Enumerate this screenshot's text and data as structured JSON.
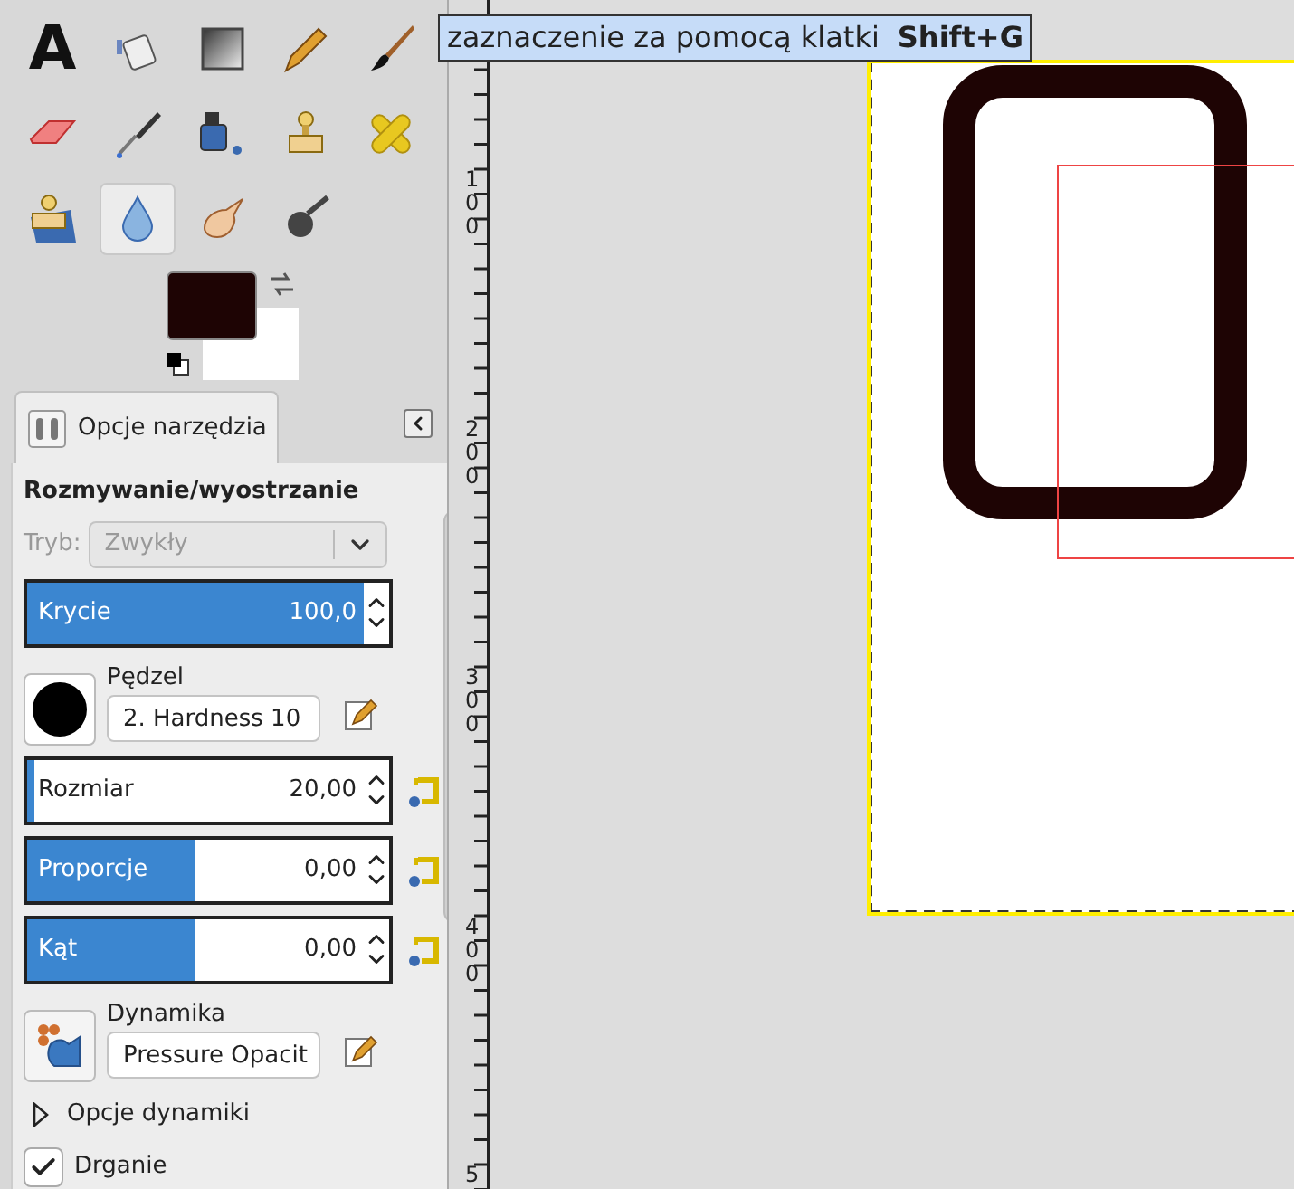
{
  "tooltip": {
    "text": "zaznaczenie za pomocą klatki",
    "shortcut": "Shift+G"
  },
  "toolbox": {
    "tools": [
      {
        "kind": "text",
        "glyph": "A",
        "selected": false
      },
      {
        "kind": "bucket",
        "selected": false
      },
      {
        "kind": "gradient",
        "selected": false
      },
      {
        "kind": "pencil",
        "selected": false
      },
      {
        "kind": "paintbrush",
        "selected": false
      },
      {
        "kind": "eraser",
        "selected": false
      },
      {
        "kind": "airbrush",
        "selected": false
      },
      {
        "kind": "ink",
        "selected": false
      },
      {
        "kind": "stamp",
        "selected": false
      },
      {
        "kind": "heal",
        "selected": false
      },
      {
        "kind": "perspective-stamp",
        "selected": false
      },
      {
        "kind": "drop",
        "selected": true
      },
      {
        "kind": "smudge",
        "selected": false
      },
      {
        "kind": "dodge",
        "selected": false
      }
    ]
  },
  "tool_options": {
    "tab": {
      "label": "Opcje narzędzia",
      "selected": true
    },
    "title": "Rozmywanie/wyostrzanie",
    "mode": {
      "label": "Tryb:",
      "value": "Zwykły",
      "disabled": true
    },
    "opacity": {
      "label": "Krycie",
      "value": "100,0",
      "level": 1
    },
    "brush": {
      "label": "Pędzel",
      "value": "2. Hardness 10"
    },
    "sliders": [
      {
        "label": "Rozmiar",
        "value": "20,00",
        "level": 0.02
      },
      {
        "label": "Proporcje",
        "value": "0,00",
        "level": 0.5
      },
      {
        "label": "Kąt",
        "value": "0,00",
        "level": 0.5
      }
    ],
    "dynamics": {
      "label": "Dynamika",
      "value": "Pressure Opacit"
    },
    "dynamics_options": {
      "label": "Opcje dynamiki",
      "expanded": false
    },
    "jitter": {
      "label": "Drganie",
      "checked": true
    }
  },
  "ruler": {
    "labels": [
      "100",
      "200",
      "300",
      "400",
      "5"
    ]
  }
}
